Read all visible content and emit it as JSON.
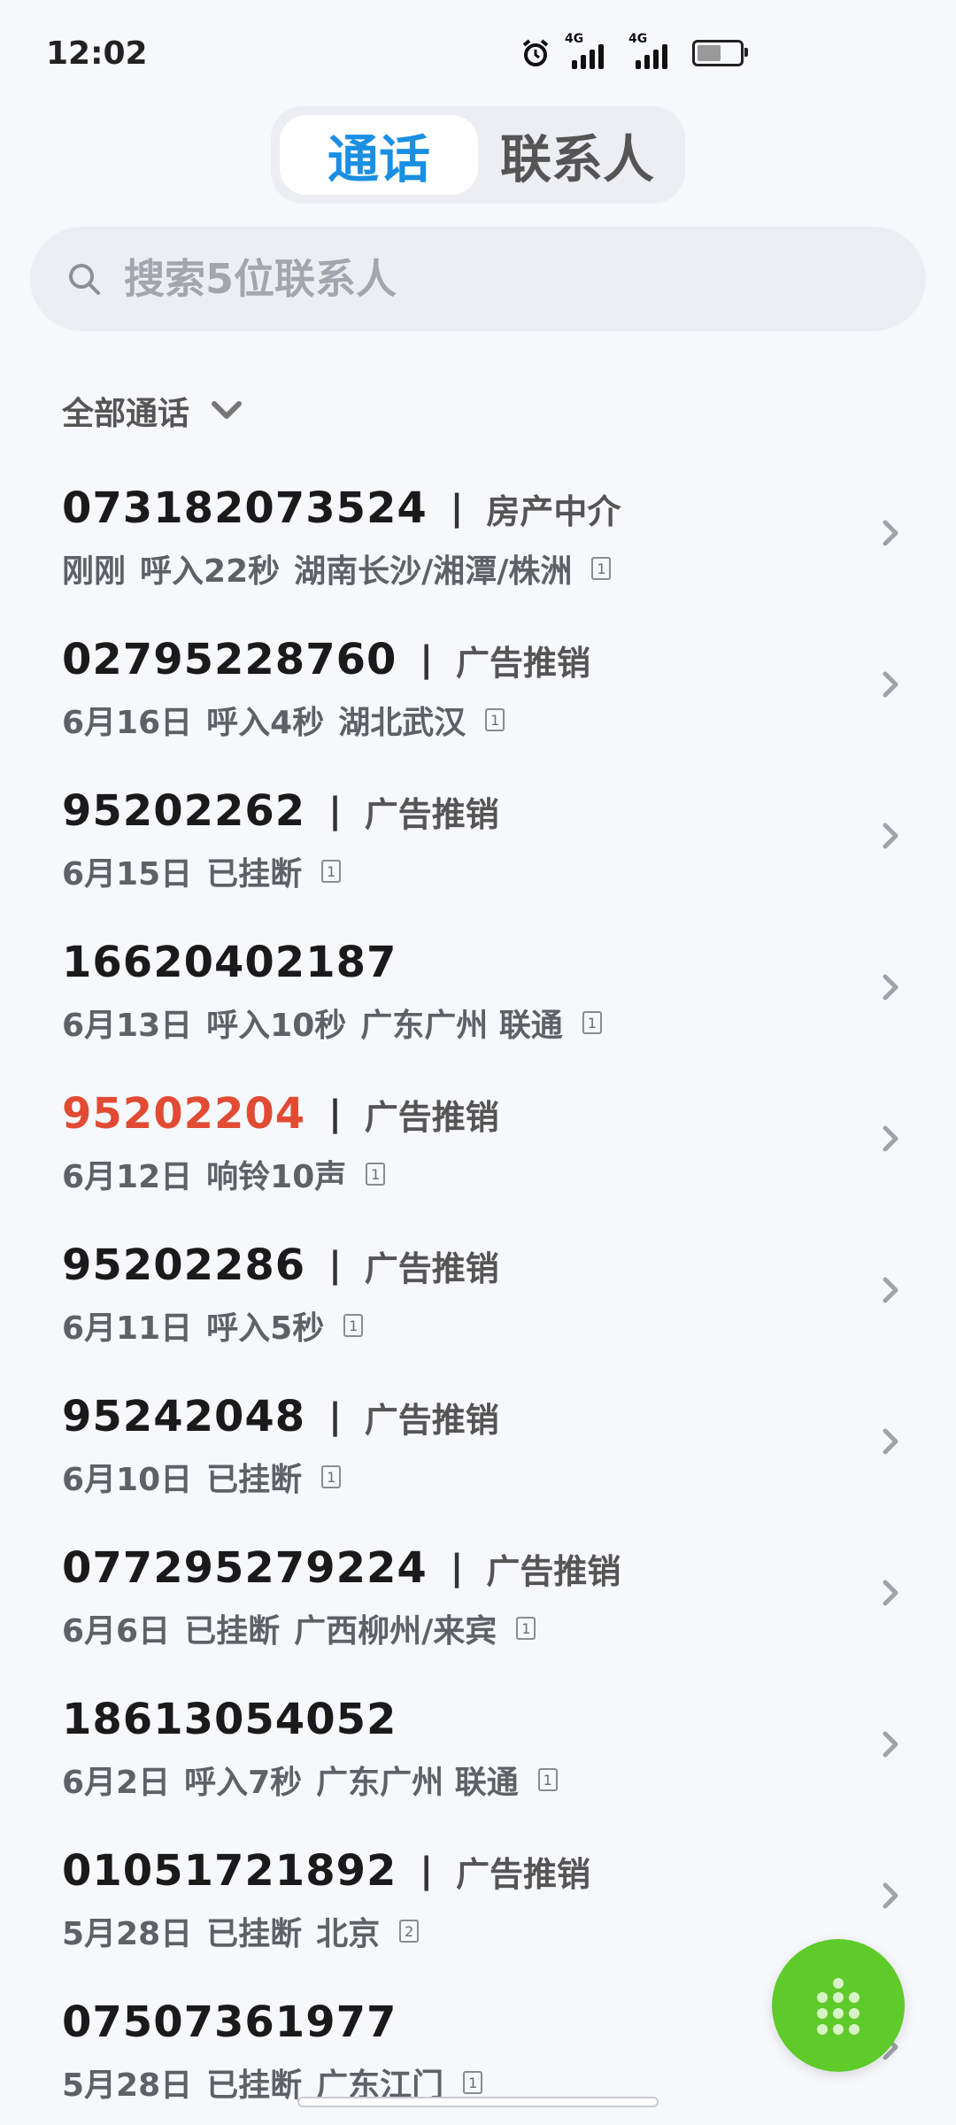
{
  "status": {
    "time": "12:02",
    "net1": "4G",
    "net2": "4G"
  },
  "tabs": [
    {
      "label": "通话",
      "active": true
    },
    {
      "label": "联系人",
      "active": false
    }
  ],
  "search": {
    "placeholder": "搜索5位联系人"
  },
  "filter": {
    "label": "全部通话"
  },
  "calls": [
    {
      "number": "073182073524",
      "tag": "房产中介",
      "date": "刚刚",
      "status": "呼入22秒",
      "location": "湖南长沙/湘潭/株洲",
      "sim": "1",
      "missed": false
    },
    {
      "number": "02795228760",
      "tag": "广告推销",
      "date": "6月16日",
      "status": "呼入4秒",
      "location": "湖北武汉",
      "sim": "1",
      "missed": false
    },
    {
      "number": "95202262",
      "tag": "广告推销",
      "date": "6月15日",
      "status": "已挂断",
      "location": "",
      "sim": "1",
      "missed": false
    },
    {
      "number": "16620402187",
      "tag": "",
      "date": "6月13日",
      "status": "呼入10秒",
      "location": "广东广州 联通",
      "sim": "1",
      "missed": false
    },
    {
      "number": "95202204",
      "tag": "广告推销",
      "date": "6月12日",
      "status": "响铃10声",
      "location": "",
      "sim": "1",
      "missed": true
    },
    {
      "number": "95202286",
      "tag": "广告推销",
      "date": "6月11日",
      "status": "呼入5秒",
      "location": "",
      "sim": "1",
      "missed": false
    },
    {
      "number": "95242048",
      "tag": "广告推销",
      "date": "6月10日",
      "status": "已挂断",
      "location": "",
      "sim": "1",
      "missed": false
    },
    {
      "number": "077295279224",
      "tag": "广告推销",
      "date": "6月6日",
      "status": "已挂断",
      "location": "广西柳州/来宾",
      "sim": "1",
      "missed": false
    },
    {
      "number": "18613054052",
      "tag": "",
      "date": "6月2日",
      "status": "呼入7秒",
      "location": "广东广州 联通",
      "sim": "1",
      "missed": false
    },
    {
      "number": "01051721892",
      "tag": "广告推销",
      "date": "5月28日",
      "status": "已挂断",
      "location": "北京",
      "sim": "2",
      "missed": false
    },
    {
      "number": "07507361977",
      "tag": "",
      "date": "5月28日",
      "status": "已挂断",
      "location": "广东江门",
      "sim": "1",
      "missed": false
    }
  ],
  "colors": {
    "accent": "#1a8fe3",
    "missed": "#e14b33",
    "fab": "#5ecb2a"
  },
  "icons": {
    "search": "search-icon",
    "filter": "chevron-down-icon",
    "row": "chevron-right-icon",
    "fab": "dialpad-icon"
  }
}
